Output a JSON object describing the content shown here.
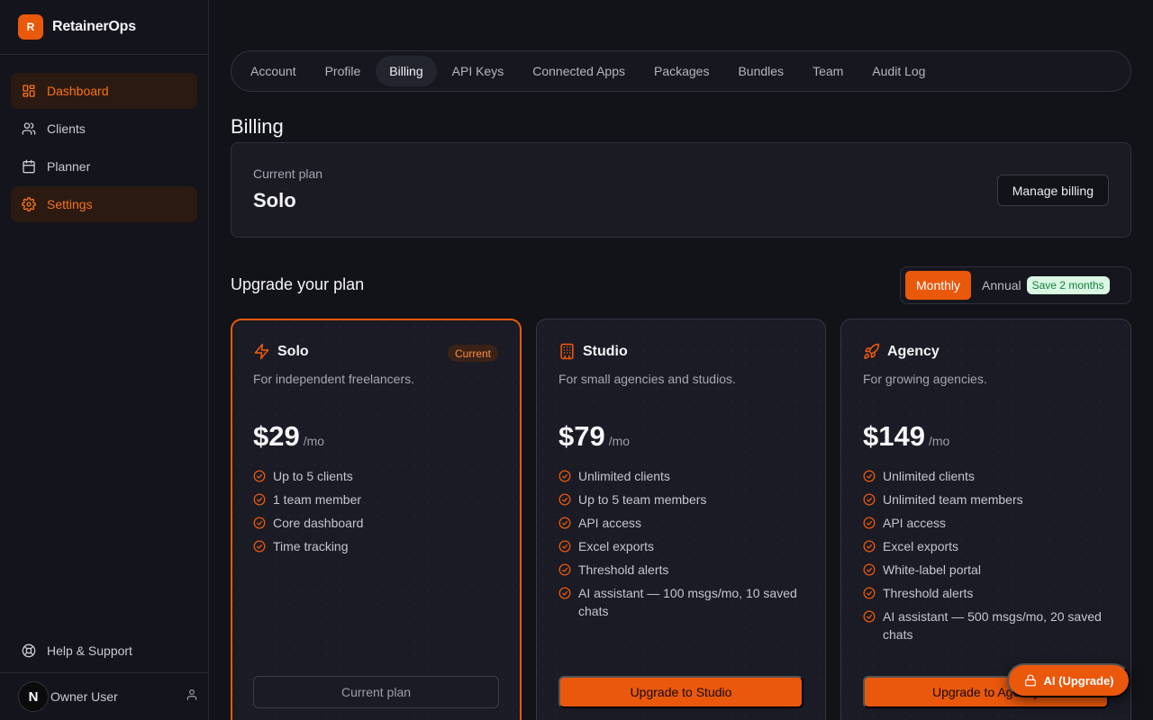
{
  "brand": {
    "logo_letter": "R",
    "name": "RetainerOps"
  },
  "sidebar": {
    "items": [
      {
        "label": "Dashboard",
        "icon": "dashboard-icon",
        "active": true
      },
      {
        "label": "Clients",
        "icon": "users-icon",
        "active": false
      },
      {
        "label": "Planner",
        "icon": "calendar-icon",
        "active": false
      },
      {
        "label": "Settings",
        "icon": "gear-icon",
        "active": true
      }
    ],
    "help_label": "Help & Support",
    "user": {
      "avatar_letter": "N",
      "name": "Owner User"
    }
  },
  "tabs": [
    "Account",
    "Profile",
    "Billing",
    "API Keys",
    "Connected Apps",
    "Packages",
    "Bundles",
    "Team",
    "Audit Log"
  ],
  "active_tab": "Billing",
  "page_title": "Billing",
  "current_plan": {
    "label": "Current plan",
    "name": "Solo",
    "manage_label": "Manage billing"
  },
  "upgrade": {
    "title": "Upgrade your plan",
    "toggle": {
      "monthly": "Monthly",
      "annual": "Annual",
      "save_badge": "Save 2 months",
      "selected": "Monthly"
    }
  },
  "plans": [
    {
      "name": "Solo",
      "icon": "bolt-icon",
      "badge": "Current",
      "description": "For independent freelancers.",
      "price": "$29",
      "per": "/mo",
      "features": [
        "Up to 5 clients",
        "1 team member",
        "Core dashboard",
        "Time tracking"
      ],
      "button": "Current plan"
    },
    {
      "name": "Studio",
      "icon": "building-icon",
      "description": "For small agencies and studios.",
      "price": "$79",
      "per": "/mo",
      "features": [
        "Unlimited clients",
        "Up to 5 team members",
        "API access",
        "Excel exports",
        "Threshold alerts",
        "AI assistant — 100 msgs/mo, 10 saved chats"
      ],
      "button": "Upgrade to Studio"
    },
    {
      "name": "Agency",
      "icon": "rocket-icon",
      "description": "For growing agencies.",
      "price": "$149",
      "per": "/mo",
      "features": [
        "Unlimited clients",
        "Unlimited team members",
        "API access",
        "Excel exports",
        "White-label portal",
        "Threshold alerts",
        "AI assistant — 500 msgs/mo, 20 saved chats"
      ],
      "button": "Upgrade to Agency"
    }
  ],
  "ai_button": "AI (Upgrade)",
  "colors": {
    "accent": "#ea580c",
    "background": "#121319",
    "card": "#1a1b24",
    "save_badge_bg": "#d9f7e3",
    "save_badge_text": "#15803d"
  }
}
